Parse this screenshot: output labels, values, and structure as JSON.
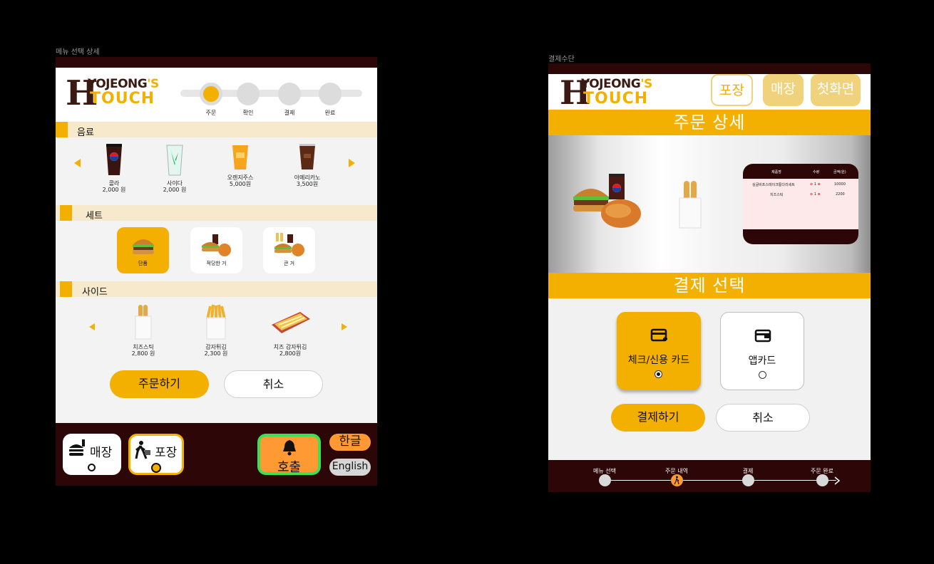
{
  "frames": {
    "left_label": "메뉴 선택 상세",
    "right_label": "결제수단"
  },
  "logo": {
    "big_letter": "H",
    "line1_text": "YOJEONG",
    "line1_apos": "'S",
    "line2": "TOUCH"
  },
  "left": {
    "steps": [
      "주문",
      "확인",
      "결제",
      "완료"
    ],
    "active_step_index": 0,
    "categories": {
      "drinks": "음료",
      "sets": "세트",
      "sides": "사이드"
    },
    "drinks": [
      {
        "name": "콜라",
        "price": "2,000 원"
      },
      {
        "name": "사이다",
        "price": "2,000 원"
      },
      {
        "name": "오렌지주스",
        "price": "5,000원"
      },
      {
        "name": "아메리카노",
        "price": "3,500원"
      }
    ],
    "sets": [
      {
        "name": "단품",
        "selected": true
      },
      {
        "name": "적당한 거",
        "selected": false
      },
      {
        "name": "큰 거",
        "selected": false
      }
    ],
    "sides": [
      {
        "name": "치즈스틱",
        "price": "2,800 원"
      },
      {
        "name": "감자튀김",
        "price": "2,300 원"
      },
      {
        "name": "치즈 감자튀김",
        "price": "2,800원"
      }
    ],
    "order_button": "주문하기",
    "cancel_button": "취소",
    "footer": {
      "dine_in": "매장",
      "takeout": "포장",
      "call": "호출",
      "korean": "한글",
      "english": "English"
    }
  },
  "right": {
    "header_buttons": {
      "takeout": "포장",
      "dine_in": "매장",
      "home": "첫화면"
    },
    "order_detail_title": "주문 상세",
    "receipt": {
      "headers": [
        "제품명",
        "수량",
        "금액(원)"
      ],
      "rows": [
        {
          "name": "싱글비프스테이크통다리세트",
          "qty": "1",
          "amount": "10000"
        },
        {
          "name": "치즈스틱",
          "qty": "1",
          "amount": "2200"
        }
      ]
    },
    "payment_title": "결제 선택",
    "payment_options": [
      {
        "label": "체크/신용 카드",
        "selected": true
      },
      {
        "label": "앱카드",
        "selected": false
      }
    ],
    "pay_button": "결제하기",
    "cancel_button": "취소",
    "footer_steps": [
      "메뉴 선택",
      "주문 내역",
      "결제",
      "주문 완료"
    ],
    "active_footer_step_index": 1
  },
  "colors": {
    "accent": "#f4b000",
    "dark_brown": "#2d0707",
    "cream": "#f6e9cc",
    "call_orange": "#ff9933",
    "call_border": "#3fe04f"
  },
  "icons": [
    "burger-icon",
    "walking-person-icon",
    "bell-icon",
    "credit-card-icon",
    "wallet-icon",
    "arrow-right-icon"
  ]
}
